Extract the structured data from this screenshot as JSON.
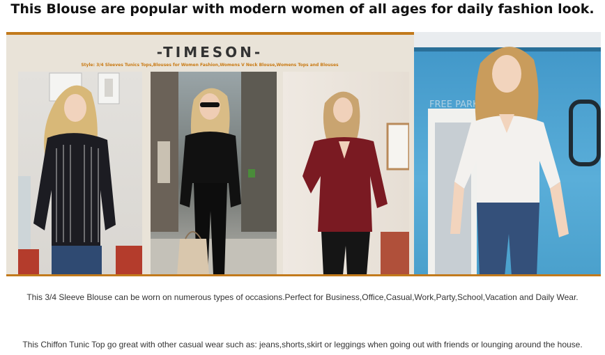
{
  "headline": "This Blouse are popular with modern women of all ages for daily fashion look.",
  "banner": {
    "brand": "-TIMESON-",
    "style_line": "Style: 3/4 Sleeves Tunics Tops,Blouses for Women Fashion,Womens V Neck Blouse,Womens Tops and Blouses",
    "accent_color": "#c27a1c",
    "photos": [
      {
        "name": "model-black-striped-blouse",
        "blouse_color": "#1c1c22"
      },
      {
        "name": "model-black-blouse",
        "blouse_color": "#111111"
      },
      {
        "name": "model-burgundy-blouse",
        "blouse_color": "#7a1a22"
      },
      {
        "name": "model-white-blouse",
        "blouse_color": "#f3f1ee"
      }
    ],
    "wall_sign": "FREE PARK"
  },
  "captions": [
    "This 3/4 Sleeve Blouse can be worn on numerous types of occasions.Perfect for Business,Office,Casual,Work,Party,School,Vacation and Daily Wear.",
    "This Chiffon Tunic Top go great with other casual wear such as: jeans,shorts,skirt or leggings when going out with friends or lounging around the house."
  ]
}
